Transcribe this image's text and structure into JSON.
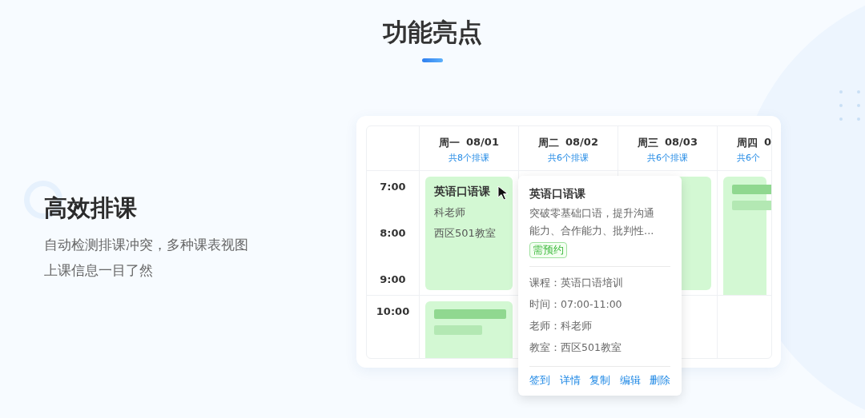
{
  "section_title": "功能亮点",
  "feature": {
    "title": "高效排课",
    "description": [
      "自动检测排课冲突，多种课表视图",
      "上课信息一目了然"
    ]
  },
  "schedule": {
    "days": [
      {
        "day": "周一",
        "date": "08/01",
        "count": "共8个排课"
      },
      {
        "day": "周二",
        "date": "08/02",
        "count": "共6个排课"
      },
      {
        "day": "周三",
        "date": "08/03",
        "count": "共6个排课"
      },
      {
        "day": "周四",
        "date": "0",
        "count": "共6个"
      }
    ],
    "rows": [
      {
        "times": [
          "7:00",
          "8:00",
          "9:00"
        ],
        "cells": [
          {
            "kind": "event",
            "title": "英语口语课",
            "teacher": "科老师",
            "room": "西区501教室"
          },
          {
            "kind": "empty"
          },
          {
            "kind": "block"
          },
          {
            "kind": "skeleton"
          }
        ]
      },
      {
        "times": [
          "10:00"
        ],
        "cells": [
          {
            "kind": "skeleton"
          },
          {
            "kind": "empty"
          },
          {
            "kind": "empty"
          },
          {
            "kind": "empty"
          }
        ]
      }
    ]
  },
  "popover": {
    "title": "英语口语课",
    "summary": "突破零基础口语，提升沟通能力、合作能力、批判性...",
    "tag": "需预约",
    "fields": [
      {
        "label": "课程：",
        "value": "英语口语培训"
      },
      {
        "label": "时间：",
        "value": "07:00-11:00"
      },
      {
        "label": "老师：",
        "value": "科老师"
      },
      {
        "label": "教室：",
        "value": "西区501教室"
      }
    ],
    "actions": [
      "签到",
      "详情",
      "复制",
      "编辑",
      "删除"
    ]
  }
}
